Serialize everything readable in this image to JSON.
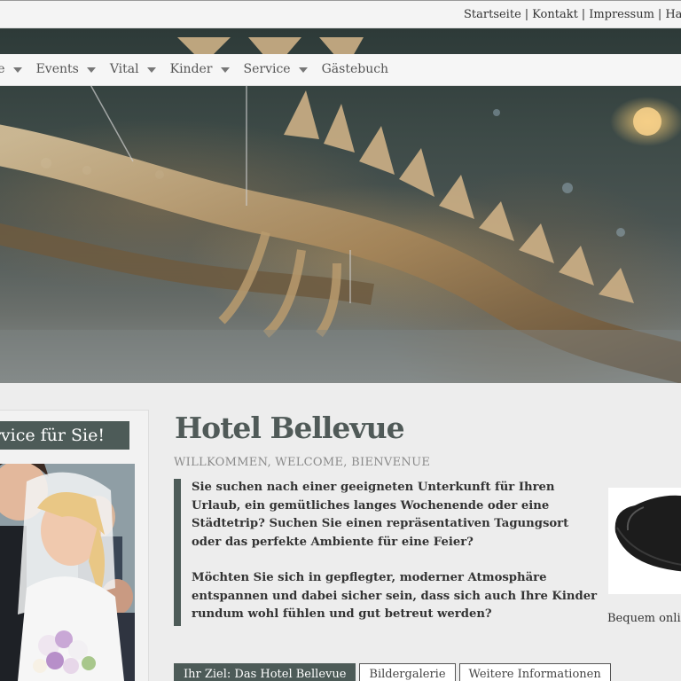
{
  "topbar": {
    "links": [
      "Startseite",
      "Kontakt",
      "Impressum",
      "Haftu"
    ]
  },
  "nav": {
    "items": [
      {
        "label": "me",
        "has_dropdown": true
      },
      {
        "label": "Events",
        "has_dropdown": true
      },
      {
        "label": "Vital",
        "has_dropdown": true
      },
      {
        "label": "Kinder",
        "has_dropdown": true
      },
      {
        "label": "Service",
        "has_dropdown": true
      },
      {
        "label": "Gästebuch",
        "has_dropdown": false
      }
    ]
  },
  "sidebar": {
    "title": "Service für Sie!"
  },
  "main": {
    "title": "Hotel Bellevue",
    "subtitle": "WILLKOMMEN, WELCOME, BIENVENUE",
    "paragraph1": "Sie suchen nach einer geeigneten Unterkunft für Ihren Urlaub, ein gemütliches langes Wochenende oder eine Städtetrip? Suchen Sie einen repräsentativen Tagungsort oder das perfekte Ambiente für eine Feier?",
    "paragraph2": "Möchten Sie sich in gepflegter, moderner Atmosphäre entspannen und dabei sicher sein, dass sich auch Ihre Kinder rundum wohl fühlen und gut betreut werden?"
  },
  "teaser": {
    "caption": "Bequem onlin"
  },
  "tabs": [
    {
      "label": "Ihr Ziel: Das Hotel Bellevue",
      "active": true
    },
    {
      "label": "Bildergalerie",
      "active": false
    },
    {
      "label": "Weitere Informationen",
      "active": false
    }
  ],
  "colors": {
    "accent": "#4d5b58",
    "background": "#ececec"
  }
}
